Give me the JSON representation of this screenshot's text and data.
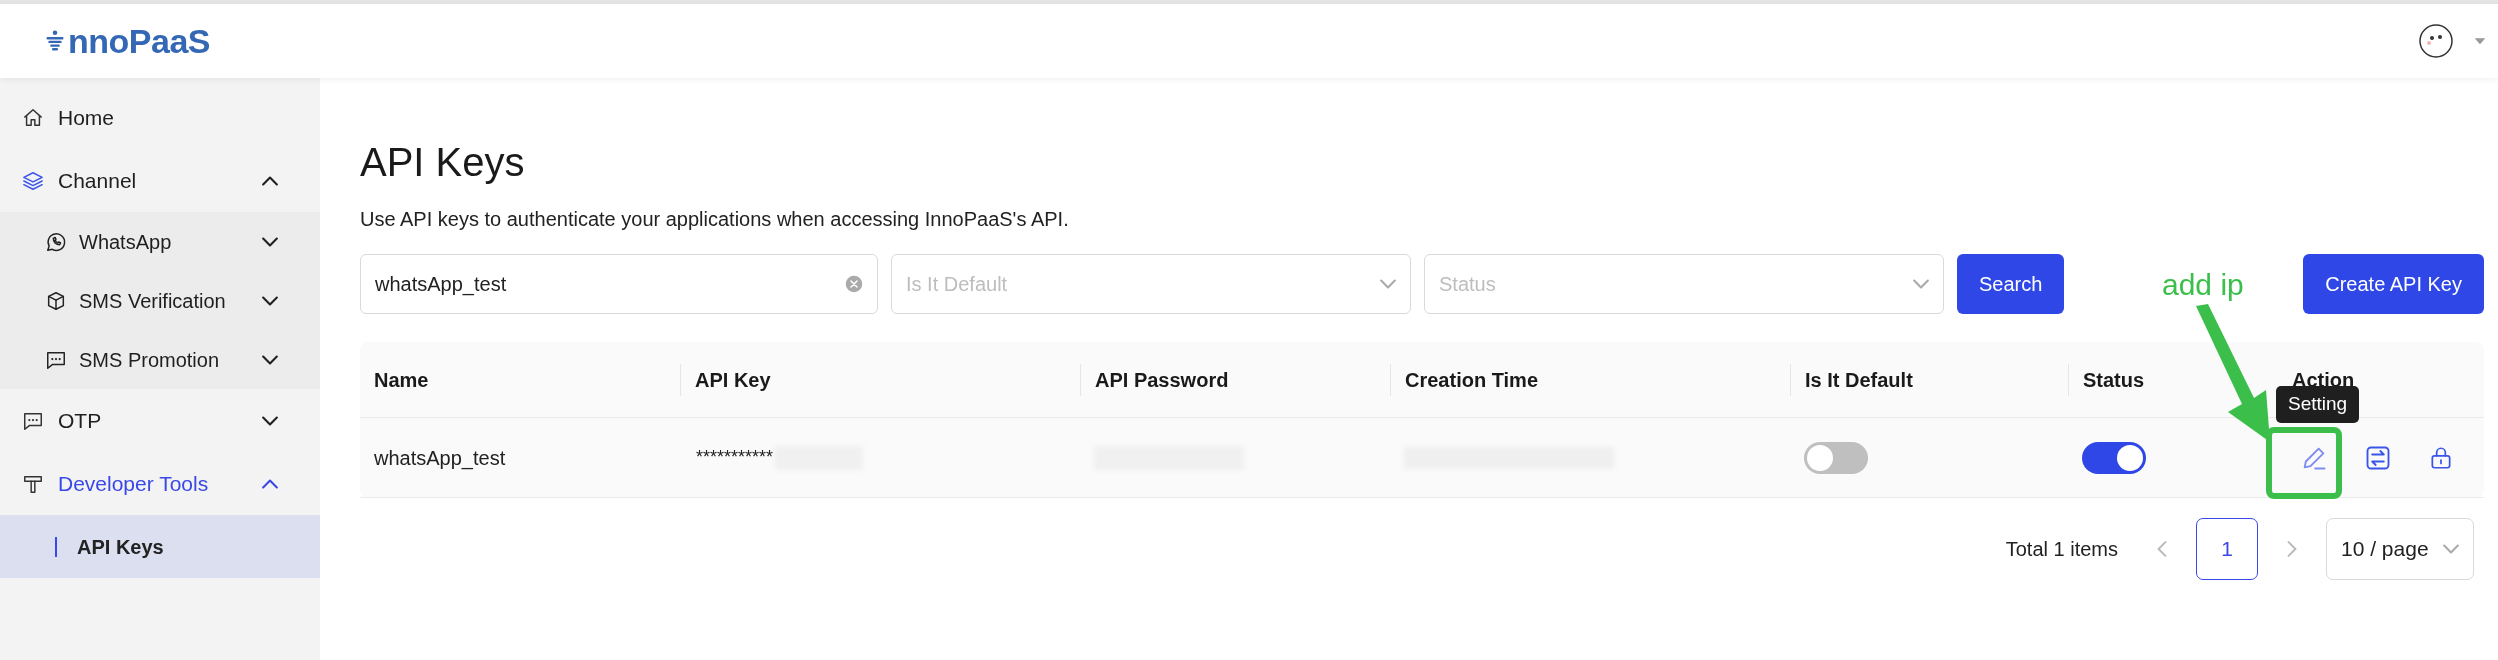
{
  "header": {
    "logo": "nnoPaaS"
  },
  "sidebar": {
    "items": [
      {
        "label": "Home",
        "selected": false
      },
      {
        "label": "Channel",
        "expanded": true,
        "children": [
          {
            "label": "WhatsApp",
            "expanded": false
          },
          {
            "label": "SMS Verification",
            "expanded": false
          },
          {
            "label": "SMS Promotion",
            "expanded": false
          }
        ]
      },
      {
        "label": "OTP",
        "expanded": false
      },
      {
        "label": "Developer Tools",
        "expanded": true,
        "children": [
          {
            "label": "API Keys",
            "selected": true
          }
        ]
      }
    ]
  },
  "page": {
    "title": "API Keys",
    "description": "Use API keys to authenticate your applications when accessing InnoPaaS's API."
  },
  "filters": {
    "name": {
      "value": "whatsApp_test"
    },
    "is_default": {
      "placeholder": "Is It Default"
    },
    "status": {
      "placeholder": "Status"
    },
    "search_button": "Search",
    "create_button": "Create API Key"
  },
  "table": {
    "columns": [
      "Name",
      "API Key",
      "API Password",
      "Creation Time",
      "Is It Default",
      "Status",
      "Action"
    ],
    "rows": [
      {
        "name": "whatsApp_test",
        "api_key": "***********",
        "is_default": {
          "on": false
        },
        "status": {
          "on": true
        }
      }
    ]
  },
  "tooltip": "Setting",
  "annotation": {
    "label": "add ip"
  },
  "pagination": {
    "total": "Total 1 items",
    "pages": [
      {
        "label": "1",
        "selected": true
      }
    ],
    "page_size": "10 / page"
  }
}
